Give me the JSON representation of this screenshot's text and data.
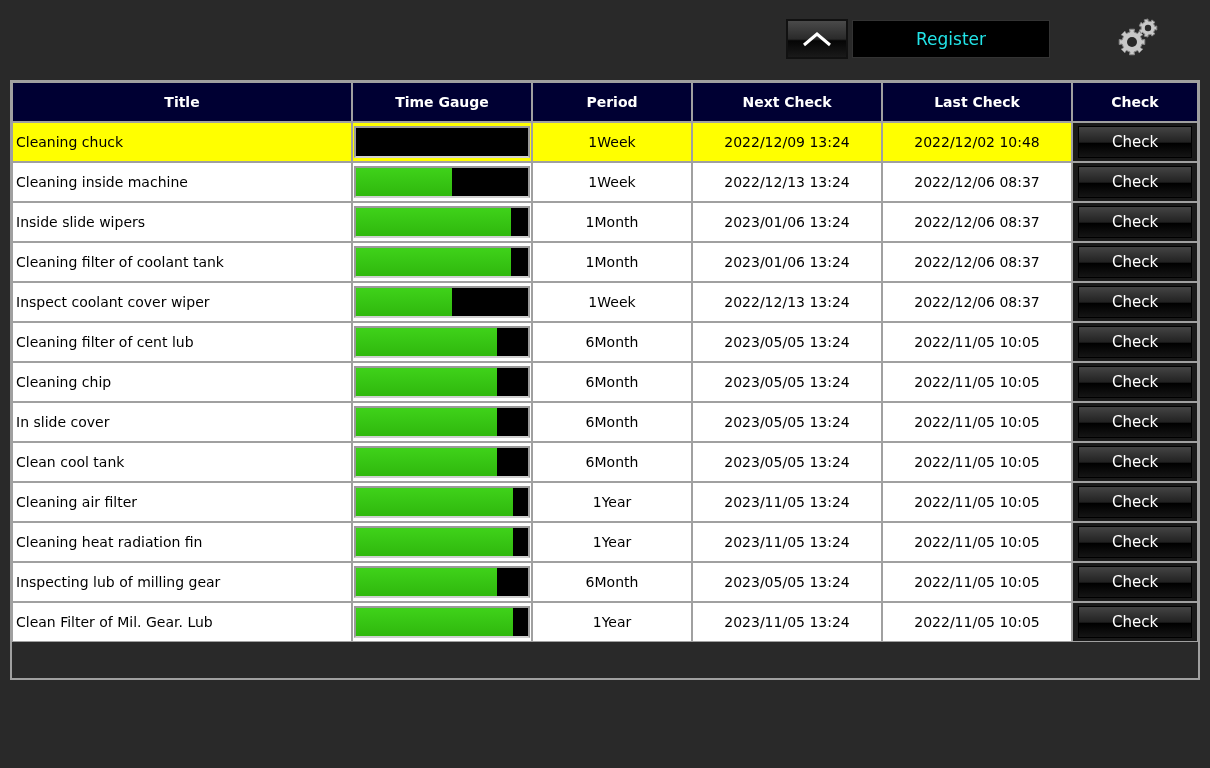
{
  "header": {
    "register_label": "Register"
  },
  "table": {
    "columns": [
      "Title",
      "Time Gauge",
      "Period",
      "Next Check",
      "Last Check",
      "Check"
    ],
    "rows": [
      {
        "title": "Cleaning chuck",
        "level": 0,
        "period": "1Week",
        "next_check": "2022/12/09 13:24",
        "last_check": "2022/12/02 10:48",
        "button": "Check",
        "due": true
      },
      {
        "title": "Cleaning inside machine",
        "level": 0.56,
        "period": "1Week",
        "next_check": "2022/12/13 13:24",
        "last_check": "2022/12/06 08:37",
        "button": "Check",
        "due": false
      },
      {
        "title": "Inside slide wipers",
        "level": 0.9,
        "period": "1Month",
        "next_check": "2023/01/06 13:24",
        "last_check": "2022/12/06 08:37",
        "button": "Check",
        "due": false
      },
      {
        "title": "Cleaning filter of coolant tank",
        "level": 0.9,
        "period": "1Month",
        "next_check": "2023/01/06 13:24",
        "last_check": "2022/12/06 08:37",
        "button": "Check",
        "due": false
      },
      {
        "title": "Inspect coolant cover wiper",
        "level": 0.56,
        "period": "1Week",
        "next_check": "2022/12/13 13:24",
        "last_check": "2022/12/06 08:37",
        "button": "Check",
        "due": false
      },
      {
        "title": "Cleaning filter of cent lub",
        "level": 0.82,
        "period": "6Month",
        "next_check": "2023/05/05 13:24",
        "last_check": "2022/11/05 10:05",
        "button": "Check",
        "due": false
      },
      {
        "title": "Cleaning chip",
        "level": 0.82,
        "period": "6Month",
        "next_check": "2023/05/05 13:24",
        "last_check": "2022/11/05 10:05",
        "button": "Check",
        "due": false
      },
      {
        "title": "In slide cover",
        "level": 0.82,
        "period": "6Month",
        "next_check": "2023/05/05 13:24",
        "last_check": "2022/11/05 10:05",
        "button": "Check",
        "due": false
      },
      {
        "title": "Clean cool tank",
        "level": 0.82,
        "period": "6Month",
        "next_check": "2023/05/05 13:24",
        "last_check": "2022/11/05 10:05",
        "button": "Check",
        "due": false
      },
      {
        "title": "Cleaning air filter",
        "level": 0.91,
        "period": "1Year",
        "next_check": "2023/11/05 13:24",
        "last_check": "2022/11/05 10:05",
        "button": "Check",
        "due": false
      },
      {
        "title": "Cleaning heat radiation fin",
        "level": 0.91,
        "period": "1Year",
        "next_check": "2023/11/05 13:24",
        "last_check": "2022/11/05 10:05",
        "button": "Check",
        "due": false
      },
      {
        "title": "Inspecting lub of milling gear",
        "level": 0.82,
        "period": "6Month",
        "next_check": "2023/05/05 13:24",
        "last_check": "2022/11/05 10:05",
        "button": "Check",
        "due": false
      },
      {
        "title": "Clean Filter of Mil. Gear. Lub",
        "level": 0.91,
        "period": "1Year",
        "next_check": "2023/11/05 13:24",
        "last_check": "2022/11/05 10:05",
        "button": "Check",
        "due": false
      }
    ]
  }
}
